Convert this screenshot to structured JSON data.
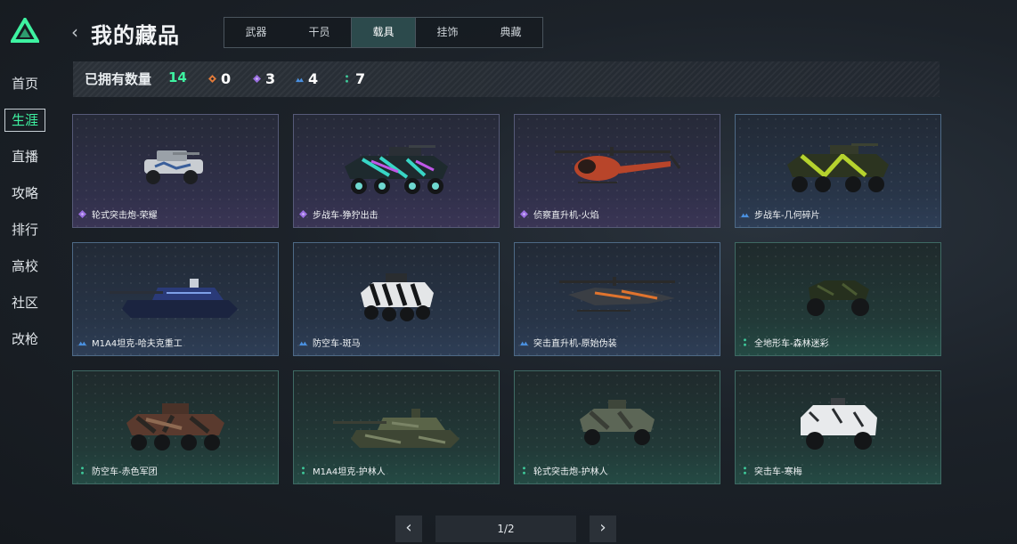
{
  "nav": [
    "首页",
    "生涯",
    "直播",
    "攻略",
    "排行",
    "高校",
    "社区",
    "改枪"
  ],
  "header": {
    "back_icon": "chevron-left",
    "title": "我的藏品"
  },
  "tabs": [
    "武器",
    "干员",
    "载具",
    "挂饰",
    "典藏"
  ],
  "stats": {
    "owned_label": "已拥有数量",
    "owned_count": "14",
    "tiers": [
      {
        "color": "#e07a3a",
        "value": "0"
      },
      {
        "color": "#9a6ee0",
        "value": "3"
      },
      {
        "color": "#4a90e0",
        "value": "4"
      },
      {
        "color": "#3ec99a",
        "value": "7"
      }
    ]
  },
  "cards": [
    {
      "name": "轮式突击炮-荣耀",
      "tier": "purple"
    },
    {
      "name": "步战车-狰狞出击",
      "tier": "purple"
    },
    {
      "name": "侦察直升机-火焰",
      "tier": "purple"
    },
    {
      "name": "步战车-几何碎片",
      "tier": "blue"
    },
    {
      "name": "M1A4坦克-哈夫克重工",
      "tier": "blue"
    },
    {
      "name": "防空车-斑马",
      "tier": "blue"
    },
    {
      "name": "突击直升机-原始伪装",
      "tier": "blue"
    },
    {
      "name": "全地形车-森林迷彩",
      "tier": "green"
    },
    {
      "name": "防空车-赤色军团",
      "tier": "green"
    },
    {
      "name": "M1A4坦克-护林人",
      "tier": "green"
    },
    {
      "name": "轮式突击炮-护林人",
      "tier": "green"
    },
    {
      "name": "突击车-寒梅",
      "tier": "green"
    }
  ],
  "tier_colors": {
    "purple": "#9a6ee0",
    "blue": "#4a90e0",
    "green": "#3ec99a"
  },
  "pager": {
    "text": "1/2",
    "prev_icon": "chevron-left",
    "next_icon": "chevron-right"
  }
}
